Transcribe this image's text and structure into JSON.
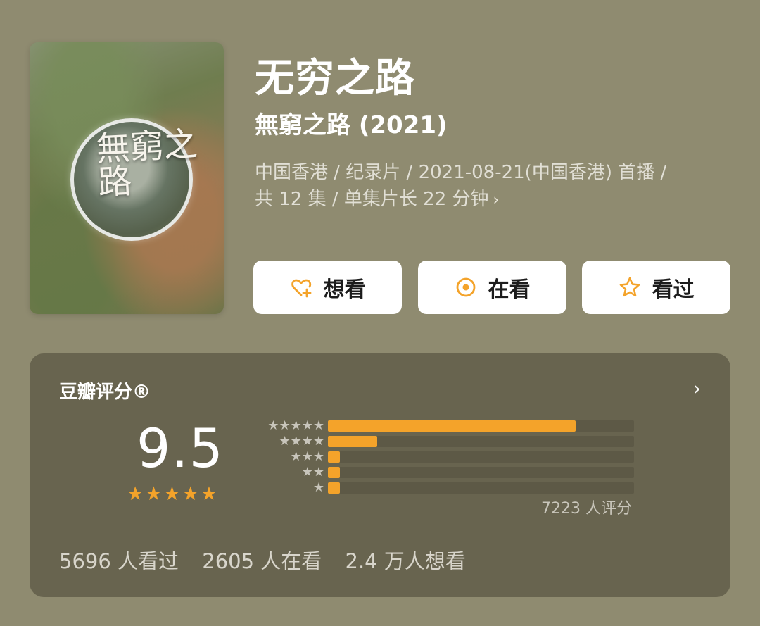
{
  "poster": {
    "title_text": "無窮之路"
  },
  "title": "无穷之路",
  "subtitle": "無窮之路 (2021)",
  "meta": {
    "line1": "中国香港 / 纪录片 / 2021-08-21(中国香港) 首播 /",
    "line2": "共 12 集 / 单集片长 22 分钟"
  },
  "buttons": [
    {
      "label": "想看",
      "icon": "heart-plus-icon"
    },
    {
      "label": "在看",
      "icon": "record-icon"
    },
    {
      "label": "看过",
      "icon": "star-outline-icon"
    }
  ],
  "rating": {
    "source": "豆瓣评分®",
    "score": "9.5",
    "stars_display": "★★★★★",
    "count_text": "7223 人评分",
    "distribution": [
      {
        "stars": "★★★★★",
        "percent": 81
      },
      {
        "stars": "★★★★",
        "percent": 16
      },
      {
        "stars": "★★★",
        "percent": 2
      },
      {
        "stars": "★★",
        "percent": 1
      },
      {
        "stars": "★",
        "percent": 1
      }
    ]
  },
  "stats": {
    "watched": "5696 人看过",
    "watching": "2605 人在看",
    "want": "2.4 万人想看"
  },
  "colors": {
    "background": "#8f8b70",
    "accent": "#f4a32a",
    "button_bg": "#ffffff"
  }
}
